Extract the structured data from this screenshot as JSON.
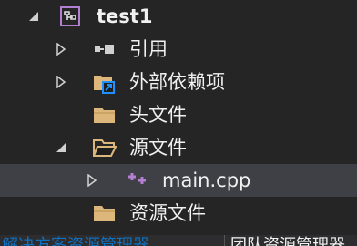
{
  "tree": {
    "project": {
      "label": "test1",
      "icon": "project-icon",
      "expanded": true
    },
    "references": {
      "label": "引用",
      "icon": "references-icon",
      "expanded": false
    },
    "external_deps": {
      "label": "外部依赖项",
      "icon": "external-dependencies-icon",
      "expanded": false
    },
    "header_files": {
      "label": "头文件",
      "icon": "folder-icon"
    },
    "source_files": {
      "label": "源文件",
      "icon": "folder-open-icon",
      "expanded": true
    },
    "main_cpp": {
      "label": "main.cpp",
      "icon": "cpp-file-icon",
      "expanded": false
    },
    "resource_files": {
      "label": "资源文件",
      "icon": "folder-icon"
    }
  },
  "bottom_tabs": {
    "solution_explorer": "解决方案资源管理器",
    "team_explorer": "团队资源管理器"
  },
  "colors": {
    "background": "#252526",
    "selection": "#3f3f46",
    "active_tab": "#0e70c0",
    "folder": "#dcb67a",
    "project_icon": "#b37fd1"
  }
}
